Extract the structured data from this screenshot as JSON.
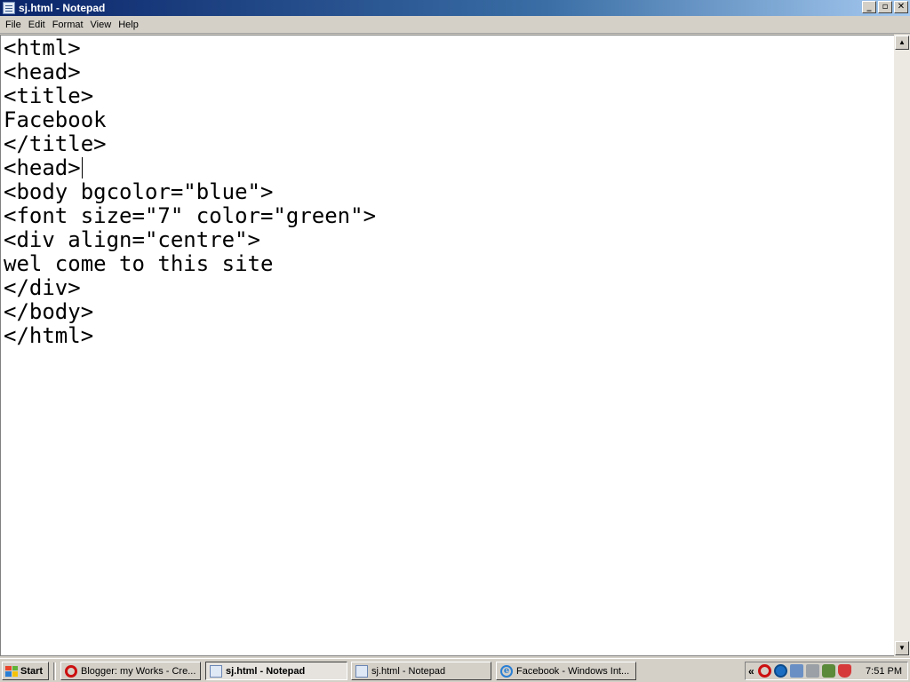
{
  "window": {
    "title": "sj.html - Notepad",
    "buttons": {
      "minimize": "_",
      "maximize": "▫",
      "close": "✕"
    }
  },
  "menu": [
    "File",
    "Edit",
    "Format",
    "View",
    "Help"
  ],
  "editor": {
    "lines": [
      "<html>",
      "<head>",
      "<title>",
      "Facebook",
      "</title>",
      "<head>",
      "<body bgcolor=\"blue\">",
      "<font size=\"7\" color=\"green\">",
      "<div align=\"centre\">",
      "wel come to this site",
      "</div>",
      "</body>",
      "</html>"
    ]
  },
  "scrollbar": {
    "up": "▲",
    "down": "▼"
  },
  "taskbar": {
    "start_label": "Start",
    "tasks": [
      {
        "label": "Blogger: my Works - Cre...",
        "icon": "opera-icon"
      },
      {
        "label": "sj.html - Notepad",
        "icon": "notepad-icon",
        "active": true
      },
      {
        "label": "sj.html - Notepad",
        "icon": "notepad-icon"
      },
      {
        "label": "Facebook - Windows Int...",
        "icon": "ie-icon"
      }
    ],
    "tray": {
      "chevron": "«",
      "icons": [
        "opera-tray-icon",
        "security-tray-icon",
        "network-tray-icon",
        "volume-tray-icon",
        "mouse-tray-icon",
        "antivirus-tray-icon"
      ],
      "clock": "7:51 PM"
    }
  }
}
